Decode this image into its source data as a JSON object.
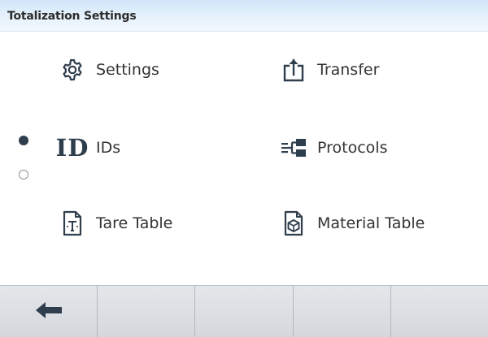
{
  "title_bar": {
    "title": "Totalization Settings"
  },
  "menu": {
    "items": [
      {
        "label": "Settings",
        "icon": "gear-icon"
      },
      {
        "label": "Transfer",
        "icon": "transfer-icon"
      },
      {
        "label": "IDs",
        "icon": "id-icon",
        "icon_text": "ID"
      },
      {
        "label": "Protocols",
        "icon": "protocols-icon"
      },
      {
        "label": "Tare Table",
        "icon": "tare-table-icon"
      },
      {
        "label": "Material Table",
        "icon": "material-table-icon"
      }
    ]
  },
  "pagination": {
    "pages": 2,
    "current_page": 1
  },
  "softkeys": [
    {
      "icon": "back-arrow-icon"
    },
    {
      "icon": ""
    },
    {
      "icon": ""
    },
    {
      "icon": ""
    },
    {
      "icon": ""
    }
  ],
  "colors": {
    "title_bar": "#dcecf9",
    "icon": "#2f3e4c",
    "softkey_bar": "#dde0e3"
  }
}
